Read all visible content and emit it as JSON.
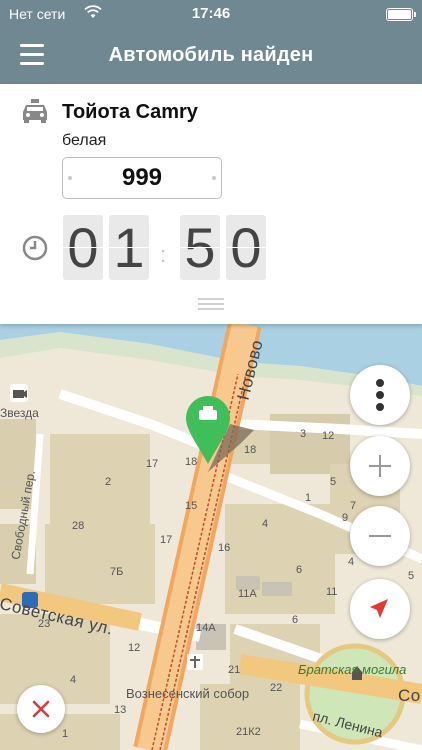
{
  "status_bar": {
    "carrier": "Нет сети",
    "time": "17:46"
  },
  "nav": {
    "title": "Автомобиль найден",
    "menu_icon": "hamburger-icon"
  },
  "car": {
    "model": "Тойота Camry",
    "color": "белая",
    "plate": "999",
    "icon": "taxi-icon"
  },
  "timer": {
    "digits": [
      "0",
      "1",
      "5",
      "0"
    ],
    "icon": "clock-icon"
  },
  "map": {
    "labels": {
      "zvezda": "Звезда",
      "svobodny": "Свободный пер.",
      "sovetskaya": "Советская ул.",
      "novovo": "Новово",
      "voznesensky": "Вознесенский собор",
      "bratskaya": "Братская могила",
      "lenina": "пл. Ленина",
      "so": "Со"
    },
    "house_numbers": [
      "18",
      "3",
      "12",
      "17",
      "2",
      "15",
      "28",
      "7Б",
      "16",
      "11А",
      "4",
      "1",
      "9",
      "14А",
      "21",
      "22",
      "21К2",
      "12",
      "13",
      "4",
      "1",
      "23",
      "6",
      "6",
      "11",
      "4",
      "7",
      "5",
      "5",
      "17",
      "18"
    ]
  },
  "colors": {
    "header": "#6f8891",
    "pin": "#3fbe5a",
    "nav_arrow": "#e33a32",
    "cancel": "#d63c3c"
  }
}
